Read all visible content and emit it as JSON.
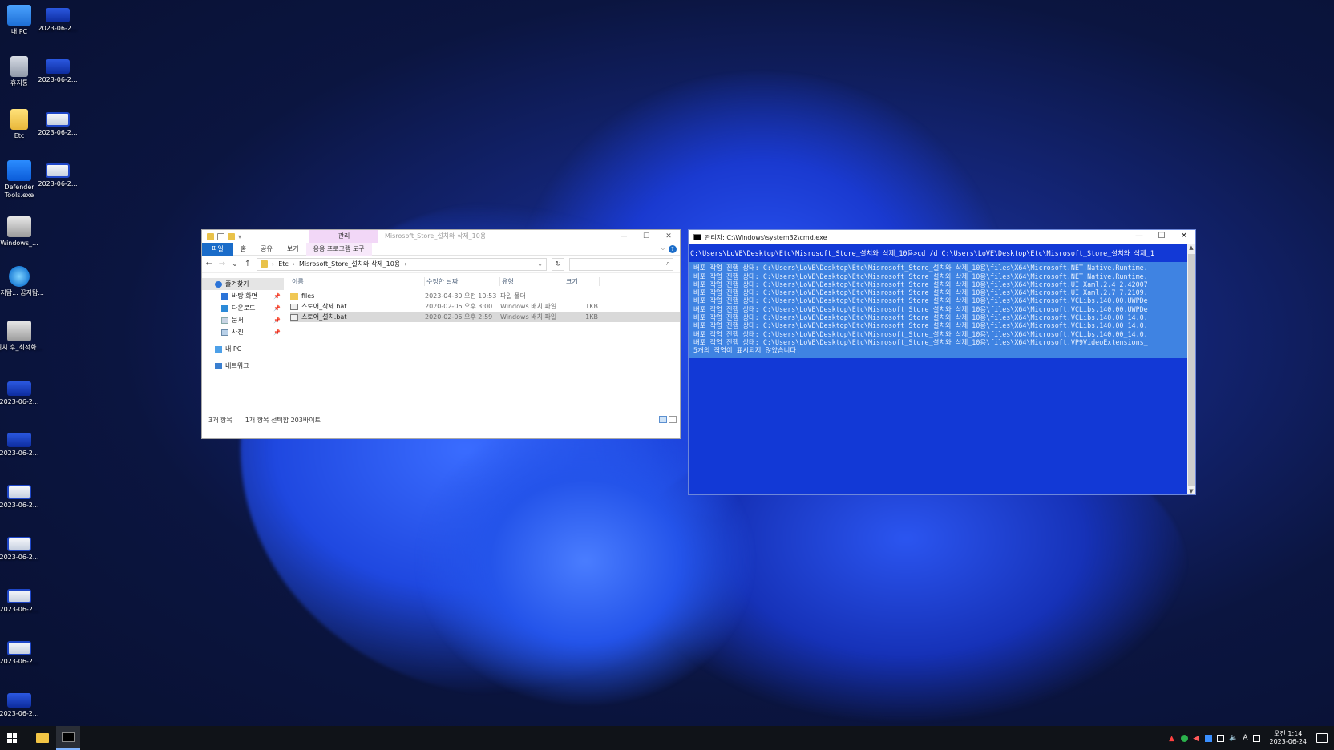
{
  "desktop": {
    "icons_left": [
      {
        "label": "내 PC",
        "icon": "pc-icon"
      },
      {
        "label": "휴지통",
        "icon": "recycle-bin-icon"
      },
      {
        "label": "Etc",
        "icon": "folder-icon"
      },
      {
        "label": "Defender Tools.exe",
        "icon": "shield-icon"
      },
      {
        "label": "Windows_...",
        "icon": "gear-icon"
      },
      {
        "label": "공지탐... 꿈지탐...",
        "icon": "ie-icon"
      },
      {
        "label": "설치 후_최적화...",
        "icon": "gear-icon"
      },
      {
        "label": "2023-06-2...",
        "icon": "screenshot-icon"
      },
      {
        "label": "2023-06-2...",
        "icon": "screenshot-icon"
      },
      {
        "label": "2023-06-2...",
        "icon": "screenshot-icon"
      },
      {
        "label": "2023-06-2...",
        "icon": "screenshot-icon"
      },
      {
        "label": "2023-06-2...",
        "icon": "screenshot-icon"
      },
      {
        "label": "2023-06-2...",
        "icon": "screenshot-icon"
      },
      {
        "label": "2023-06-2...",
        "icon": "screenshot-icon"
      }
    ],
    "icons_right": [
      {
        "label": "2023-06-2...",
        "icon": "screenshot-icon"
      },
      {
        "label": "2023-06-2...",
        "icon": "screenshot-icon"
      },
      {
        "label": "2023-06-2...",
        "icon": "screenshot-icon"
      },
      {
        "label": "2023-06-2...",
        "icon": "screenshot-icon"
      }
    ]
  },
  "explorer": {
    "manage_tab": "관리",
    "title": "Misrosoft_Store_설치와 삭제_10용",
    "ribbon_tabs": [
      "파일",
      "홈",
      "공유",
      "보기",
      "응용 프로그램 도구"
    ],
    "breadcrumb": [
      "Etc",
      "Misrosoft_Store_설치와 삭제_10용"
    ],
    "search_placeholder": "",
    "nav": {
      "favorites": "즐겨찾기",
      "desktop": "바탕 화면",
      "downloads": "다운로드",
      "documents": "문서",
      "pictures": "사진",
      "pc": "내 PC",
      "network": "네트워크"
    },
    "columns": {
      "name": "이름",
      "date": "수정한 날짜",
      "type": "유형",
      "size": "크기"
    },
    "files": [
      {
        "name": "files",
        "date": "2023-04-30 오전 10:53",
        "type": "파일 폴더",
        "size": "",
        "kind": "folder"
      },
      {
        "name": "스토어_삭제.bat",
        "date": "2020-02-06 오후 3:00",
        "type": "Windows 배치 파일",
        "size": "1KB",
        "kind": "bat"
      },
      {
        "name": "스토어_설치.bat",
        "date": "2020-02-06 오후 2:59",
        "type": "Windows 배치 파일",
        "size": "1KB",
        "kind": "bat"
      }
    ],
    "status": {
      "count": "3개 항목",
      "selection": "1개 항목 선택함 203바이트"
    }
  },
  "cmd": {
    "title": "관리자: C:\\Windows\\system32\\cmd.exe",
    "prompt_line": "C:\\Users\\LoVE\\Desktop\\Etc\\Misrosoft_Store_설치와 삭제_10용>cd /d C:\\Users\\LoVE\\Desktop\\Etc\\Misrosoft_Store_설치와 삭제_1",
    "output_lines": [
      "배포 작업 진행 상태: C:\\Users\\LoVE\\Desktop\\Etc\\Misrosoft_Store_설치와 삭제_10용\\files\\X64\\Microsoft.NET.Native.Runtime.",
      "배포 작업 진행 상태: C:\\Users\\LoVE\\Desktop\\Etc\\Misrosoft_Store_설치와 삭제_10용\\files\\X64\\Microsoft.NET.Native.Runtime.",
      "배포 작업 진행 상태: C:\\Users\\LoVE\\Desktop\\Etc\\Misrosoft_Store_설치와 삭제_10용\\files\\X64\\Microsoft.UI.Xaml.2.4_2.42007",
      "배포 작업 진행 상태: C:\\Users\\LoVE\\Desktop\\Etc\\Misrosoft_Store_설치와 삭제_10용\\files\\X64\\Microsoft.UI.Xaml.2.7_7.2109.",
      "배포 작업 진행 상태: C:\\Users\\LoVE\\Desktop\\Etc\\Misrosoft_Store_설치와 삭제_10용\\files\\X64\\Microsoft.VCLibs.140.00.UWPDe",
      "배포 작업 진행 상태: C:\\Users\\LoVE\\Desktop\\Etc\\Misrosoft_Store_설치와 삭제_10용\\files\\X64\\Microsoft.VCLibs.140.00.UWPDe",
      "배포 작업 진행 상태: C:\\Users\\LoVE\\Desktop\\Etc\\Misrosoft_Store_설치와 삭제_10용\\files\\X64\\Microsoft.VCLibs.140.00_14.0.",
      "배포 작업 진행 상태: C:\\Users\\LoVE\\Desktop\\Etc\\Misrosoft_Store_설치와 삭제_10용\\files\\X64\\Microsoft.VCLibs.140.00_14.0.",
      "배포 작업 진행 상태: C:\\Users\\LoVE\\Desktop\\Etc\\Misrosoft_Store_설치와 삭제_10용\\files\\X64\\Microsoft.VCLibs.140.00_14.0.",
      "배포 작업 진행 상태: C:\\Users\\LoVE\\Desktop\\Etc\\Misrosoft_Store_설치와 삭제_10용\\files\\X64\\Microsoft.VP9VideoExtensions_",
      "5개의 작업이 표시되지 않았습니다."
    ]
  },
  "taskbar": {
    "clock_time": "오전 1:14",
    "clock_date": "2023-06-24",
    "ime": "A"
  },
  "colors": {
    "cmd_bg": "#1239d6",
    "cmd_selection": "#3f83e2",
    "explorer_file_tab": "#1a6cc9",
    "manage_tab": "#f2d7f7"
  }
}
